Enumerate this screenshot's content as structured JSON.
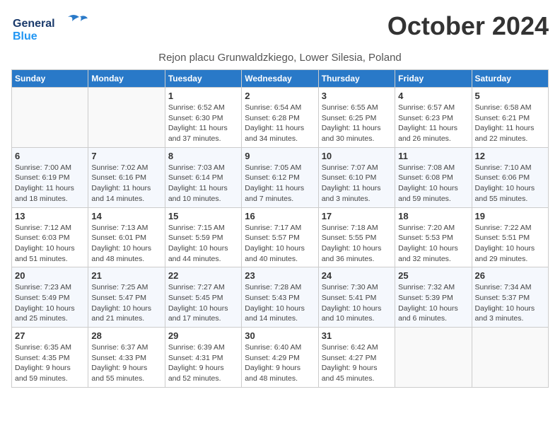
{
  "header": {
    "logo_line1": "General",
    "logo_line2": "Blue",
    "month": "October 2024",
    "location": "Rejon placu Grunwaldzkiego, Lower Silesia, Poland"
  },
  "weekdays": [
    "Sunday",
    "Monday",
    "Tuesday",
    "Wednesday",
    "Thursday",
    "Friday",
    "Saturday"
  ],
  "weeks": [
    [
      {
        "day": "",
        "info": ""
      },
      {
        "day": "",
        "info": ""
      },
      {
        "day": "1",
        "info": "Sunrise: 6:52 AM\nSunset: 6:30 PM\nDaylight: 11 hours\nand 37 minutes."
      },
      {
        "day": "2",
        "info": "Sunrise: 6:54 AM\nSunset: 6:28 PM\nDaylight: 11 hours\nand 34 minutes."
      },
      {
        "day": "3",
        "info": "Sunrise: 6:55 AM\nSunset: 6:25 PM\nDaylight: 11 hours\nand 30 minutes."
      },
      {
        "day": "4",
        "info": "Sunrise: 6:57 AM\nSunset: 6:23 PM\nDaylight: 11 hours\nand 26 minutes."
      },
      {
        "day": "5",
        "info": "Sunrise: 6:58 AM\nSunset: 6:21 PM\nDaylight: 11 hours\nand 22 minutes."
      }
    ],
    [
      {
        "day": "6",
        "info": "Sunrise: 7:00 AM\nSunset: 6:19 PM\nDaylight: 11 hours\nand 18 minutes."
      },
      {
        "day": "7",
        "info": "Sunrise: 7:02 AM\nSunset: 6:16 PM\nDaylight: 11 hours\nand 14 minutes."
      },
      {
        "day": "8",
        "info": "Sunrise: 7:03 AM\nSunset: 6:14 PM\nDaylight: 11 hours\nand 10 minutes."
      },
      {
        "day": "9",
        "info": "Sunrise: 7:05 AM\nSunset: 6:12 PM\nDaylight: 11 hours\nand 7 minutes."
      },
      {
        "day": "10",
        "info": "Sunrise: 7:07 AM\nSunset: 6:10 PM\nDaylight: 11 hours\nand 3 minutes."
      },
      {
        "day": "11",
        "info": "Sunrise: 7:08 AM\nSunset: 6:08 PM\nDaylight: 10 hours\nand 59 minutes."
      },
      {
        "day": "12",
        "info": "Sunrise: 7:10 AM\nSunset: 6:06 PM\nDaylight: 10 hours\nand 55 minutes."
      }
    ],
    [
      {
        "day": "13",
        "info": "Sunrise: 7:12 AM\nSunset: 6:03 PM\nDaylight: 10 hours\nand 51 minutes."
      },
      {
        "day": "14",
        "info": "Sunrise: 7:13 AM\nSunset: 6:01 PM\nDaylight: 10 hours\nand 48 minutes."
      },
      {
        "day": "15",
        "info": "Sunrise: 7:15 AM\nSunset: 5:59 PM\nDaylight: 10 hours\nand 44 minutes."
      },
      {
        "day": "16",
        "info": "Sunrise: 7:17 AM\nSunset: 5:57 PM\nDaylight: 10 hours\nand 40 minutes."
      },
      {
        "day": "17",
        "info": "Sunrise: 7:18 AM\nSunset: 5:55 PM\nDaylight: 10 hours\nand 36 minutes."
      },
      {
        "day": "18",
        "info": "Sunrise: 7:20 AM\nSunset: 5:53 PM\nDaylight: 10 hours\nand 32 minutes."
      },
      {
        "day": "19",
        "info": "Sunrise: 7:22 AM\nSunset: 5:51 PM\nDaylight: 10 hours\nand 29 minutes."
      }
    ],
    [
      {
        "day": "20",
        "info": "Sunrise: 7:23 AM\nSunset: 5:49 PM\nDaylight: 10 hours\nand 25 minutes."
      },
      {
        "day": "21",
        "info": "Sunrise: 7:25 AM\nSunset: 5:47 PM\nDaylight: 10 hours\nand 21 minutes."
      },
      {
        "day": "22",
        "info": "Sunrise: 7:27 AM\nSunset: 5:45 PM\nDaylight: 10 hours\nand 17 minutes."
      },
      {
        "day": "23",
        "info": "Sunrise: 7:28 AM\nSunset: 5:43 PM\nDaylight: 10 hours\nand 14 minutes."
      },
      {
        "day": "24",
        "info": "Sunrise: 7:30 AM\nSunset: 5:41 PM\nDaylight: 10 hours\nand 10 minutes."
      },
      {
        "day": "25",
        "info": "Sunrise: 7:32 AM\nSunset: 5:39 PM\nDaylight: 10 hours\nand 6 minutes."
      },
      {
        "day": "26",
        "info": "Sunrise: 7:34 AM\nSunset: 5:37 PM\nDaylight: 10 hours\nand 3 minutes."
      }
    ],
    [
      {
        "day": "27",
        "info": "Sunrise: 6:35 AM\nSunset: 4:35 PM\nDaylight: 9 hours\nand 59 minutes."
      },
      {
        "day": "28",
        "info": "Sunrise: 6:37 AM\nSunset: 4:33 PM\nDaylight: 9 hours\nand 55 minutes."
      },
      {
        "day": "29",
        "info": "Sunrise: 6:39 AM\nSunset: 4:31 PM\nDaylight: 9 hours\nand 52 minutes."
      },
      {
        "day": "30",
        "info": "Sunrise: 6:40 AM\nSunset: 4:29 PM\nDaylight: 9 hours\nand 48 minutes."
      },
      {
        "day": "31",
        "info": "Sunrise: 6:42 AM\nSunset: 4:27 PM\nDaylight: 9 hours\nand 45 minutes."
      },
      {
        "day": "",
        "info": ""
      },
      {
        "day": "",
        "info": ""
      }
    ]
  ]
}
